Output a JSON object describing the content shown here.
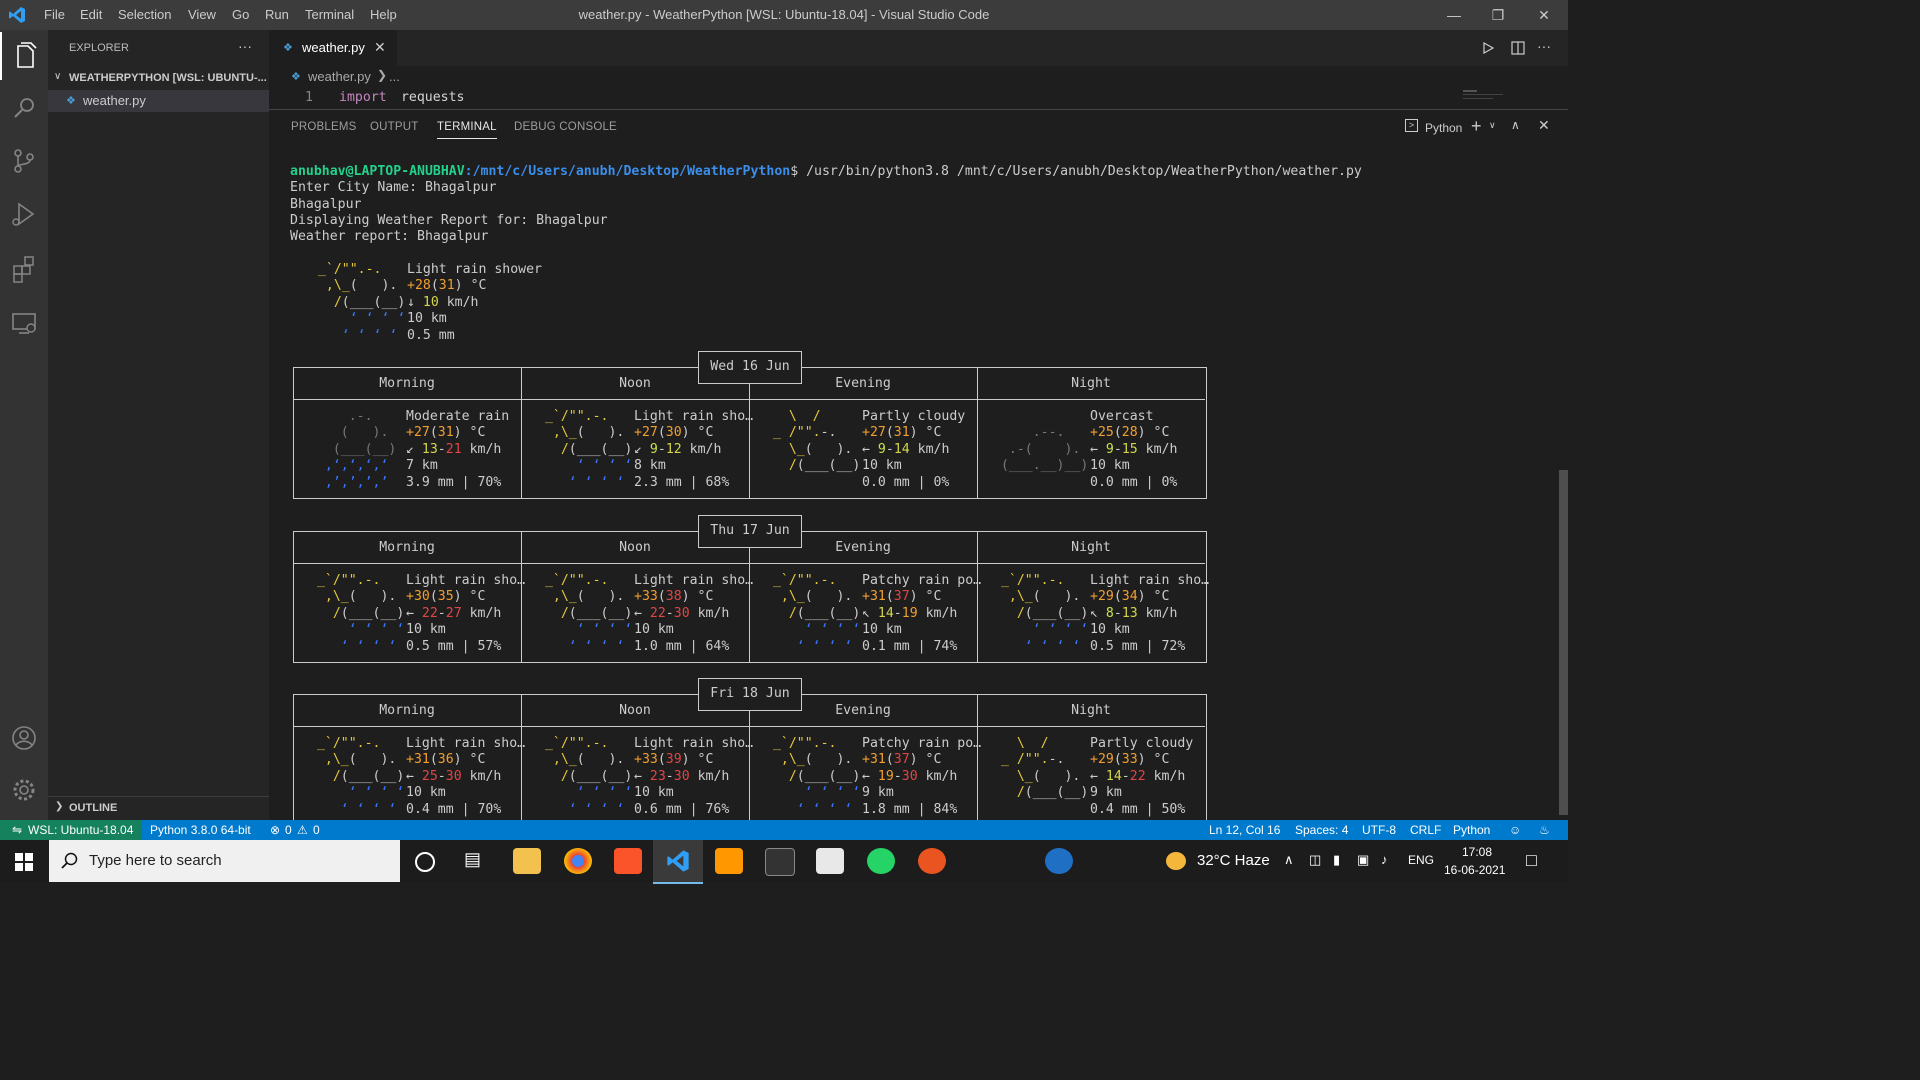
{
  "titlebar": {
    "menu": [
      "File",
      "Edit",
      "Selection",
      "View",
      "Go",
      "Run",
      "Terminal",
      "Help"
    ],
    "title": "weather.py - WeatherPython [WSL: Ubuntu-18.04] - Visual Studio Code"
  },
  "sidebar": {
    "header": "EXPLORER",
    "more": "···",
    "folder": "WEATHERPYTHON [WSL: UBUNTU-...",
    "file": "weather.py",
    "outline": "OUTLINE"
  },
  "editor": {
    "tab_label": "weather.py",
    "breadcrumb_file": "weather.py",
    "breadcrumb_more": "...",
    "line_number": "1",
    "code_keyword": "import",
    "code_rest": " requests"
  },
  "panel": {
    "tabs": [
      "PROBLEMS",
      "OUTPUT",
      "TERMINAL",
      "DEBUG CONSOLE"
    ],
    "shell_label": "Python"
  },
  "terminal": {
    "prompt_user": "anubhav@LAPTOP-ANUBHAV",
    "prompt_path": ":/mnt/c/Users/anubh/Desktop/WeatherPython",
    "prompt_cmd": "$ /usr/bin/python3.8 /mnt/c/Users/anubh/Desktop/WeatherPython/weather.py",
    "lines": [
      "Enter City Name: Bhagalpur",
      "Bhagalpur",
      "Displaying Weather Report for: Bhagalpur",
      "Weather report: Bhagalpur"
    ],
    "current": {
      "condition": "Light rain shower",
      "temp": "+28",
      "feels": "31",
      "unit": " °C",
      "wind_dir": "↓",
      "wind": "10",
      "wind_unit": " km/h",
      "visibility": "10 km",
      "precip": "0.5 mm"
    },
    "period_headers": [
      "Morning",
      "Noon",
      "Evening",
      "Night"
    ],
    "days": [
      {
        "date": "Wed 16 Jun",
        "periods": [
          {
            "cond": "Moderate rain",
            "t": "+27",
            "f": "31",
            "dir": "↙",
            "w1": "13",
            "w2": "21",
            "vis": "7 km",
            "precip": "3.9 mm | 70%",
            "icon": "heavy"
          },
          {
            "cond": "Light rain sho…",
            "t": "+27",
            "f": "30",
            "dir": "↙",
            "w1": "9",
            "w2": "12",
            "vis": "8 km",
            "precip": "2.3 mm | 68%",
            "icon": "sunrain"
          },
          {
            "cond": "Partly cloudy",
            "t": "+27",
            "f": "31",
            "dir": "←",
            "w1": "9",
            "w2": "14",
            "vis": "10 km",
            "precip": "0.0 mm | 0%",
            "icon": "partly"
          },
          {
            "cond": "Overcast",
            "t": "+25",
            "f": "28",
            "dir": "←",
            "w1": "9",
            "w2": "15",
            "vis": "10 km",
            "precip": "0.0 mm | 0%",
            "icon": "overcast"
          }
        ]
      },
      {
        "date": "Thu 17 Jun",
        "periods": [
          {
            "cond": "Light rain sho…",
            "t": "+30",
            "f": "35",
            "dir": "←",
            "w1": "22",
            "w2": "27",
            "vis": "10 km",
            "precip": "0.5 mm | 57%",
            "icon": "sunrain"
          },
          {
            "cond": "Light rain sho…",
            "t": "+33",
            "f": "38",
            "dir": "←",
            "w1": "22",
            "w2": "30",
            "vis": "10 km",
            "precip": "1.0 mm | 64%",
            "icon": "sunrain"
          },
          {
            "cond": "Patchy rain po…",
            "t": "+31",
            "f": "37",
            "dir": "↖",
            "w1": "14",
            "w2": "19",
            "vis": "10 km",
            "precip": "0.1 mm | 74%",
            "icon": "sunrain"
          },
          {
            "cond": "Light rain sho…",
            "t": "+29",
            "f": "34",
            "dir": "↖",
            "w1": "8",
            "w2": "13",
            "vis": "10 km",
            "precip": "0.5 mm | 72%",
            "icon": "sunrain"
          }
        ]
      },
      {
        "date": "Fri 18 Jun",
        "periods": [
          {
            "cond": "Light rain sho…",
            "t": "+31",
            "f": "36",
            "dir": "←",
            "w1": "25",
            "w2": "30",
            "vis": "10 km",
            "precip": "0.4 mm | 70%",
            "icon": "sunrain"
          },
          {
            "cond": "Light rain sho…",
            "t": "+33",
            "f": "39",
            "dir": "←",
            "w1": "23",
            "w2": "30",
            "vis": "10 km",
            "precip": "0.6 mm | 76%",
            "icon": "sunrain"
          },
          {
            "cond": "Patchy rain po…",
            "t": "+31",
            "f": "37",
            "dir": "←",
            "w1": "19",
            "w2": "30",
            "vis": "9 km",
            "precip": "1.8 mm | 84%",
            "icon": "sunrain"
          },
          {
            "cond": "Partly cloudy",
            "t": "+29",
            "f": "33",
            "dir": "←",
            "w1": "14",
            "w2": "22",
            "vis": "9 km",
            "precip": "0.4 mm | 50%",
            "icon": "partly"
          }
        ]
      }
    ]
  },
  "statusbar": {
    "remote": "WSL: Ubuntu-18.04",
    "interpreter": "Python 3.8.0 64-bit",
    "errors": "0",
    "warnings": "0",
    "position": "Ln 12, Col 16",
    "spaces": "Spaces: 4",
    "encoding": "UTF-8",
    "eol": "CRLF",
    "language": "Python"
  },
  "taskbar": {
    "search_placeholder": "Type here to search",
    "weather": "32°C  Haze",
    "lang": "ENG",
    "time": "17:08",
    "date": "16-06-2021"
  },
  "colors": {
    "accent": "#007acc",
    "remote": "#16825d",
    "prompt_user": "#23d18b",
    "prompt_path": "#3b8eea"
  }
}
